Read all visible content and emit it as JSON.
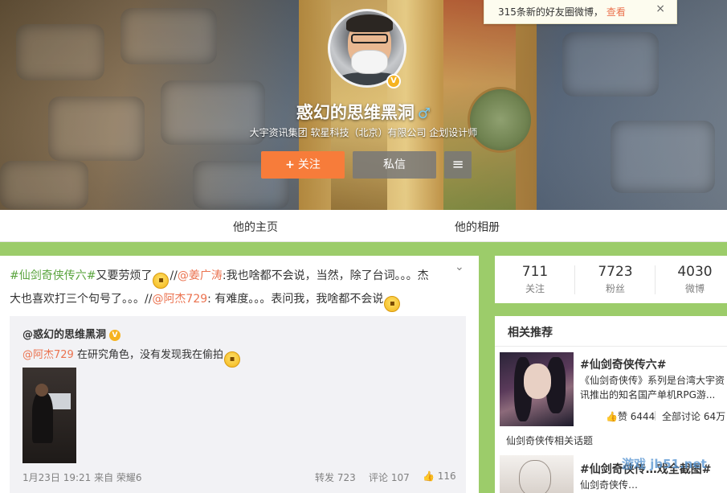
{
  "notice": {
    "text": "315条新的好友圈微博，",
    "link": "查看",
    "close": "×"
  },
  "profile": {
    "nickname": "惑幻的思维黑洞",
    "gender": "♂",
    "verified_badge": "V",
    "description": "大宇资讯集团 软星科技（北京）有限公司 企划设计师",
    "follow_label": "关注",
    "follow_plus": "+",
    "message_label": "私信",
    "menu_icon": "≡"
  },
  "tabs": [
    {
      "label": "他的主页"
    },
    {
      "label": "他的相册"
    }
  ],
  "post": {
    "collapse_icon": "⌄",
    "segments": {
      "topic": "#仙剑奇侠传六#",
      "t1": "又要劳烦了",
      "sep1": "//",
      "mention1": "@姜广涛",
      "t2": ":我也啥都不会说，当然，除了台词。。。杰大也喜欢打三个句号了。。。",
      "sep2": "//",
      "mention2": "@阿杰729",
      "t3": ": 有难度。。。表问我，我啥都不会说"
    },
    "repost": {
      "author": "@惑幻的思维黑洞",
      "author_badge": "V",
      "mention": "@阿杰729",
      "text": " 在研究角色，没有发现我在偷拍",
      "meta": "1月23日 19:21 来自 荣耀6",
      "forward": "转发 723",
      "comment": "评论 107",
      "like": "116",
      "like_icon": "👍"
    }
  },
  "stats": [
    {
      "num": "711",
      "label": "关注"
    },
    {
      "num": "7723",
      "label": "粉丝"
    },
    {
      "num": "4030",
      "label": "微博"
    }
  ],
  "recommend": {
    "heading": "相关推荐",
    "item1": {
      "title": "#仙剑奇侠传六#",
      "desc": "《仙剑奇侠传》系列是台湾大宇资讯推出的知名国产单机RPG游...",
      "likes": "赞 6444",
      "like_icon": "👍",
      "discussion": "全部讨论 64万",
      "related": "仙剑奇侠传相关话题"
    },
    "item2": {
      "title": "#仙剑奇侠传…戏全截图#",
      "desc": "仙剑奇侠传…"
    }
  },
  "watermark": "游戏 jb51.net"
}
